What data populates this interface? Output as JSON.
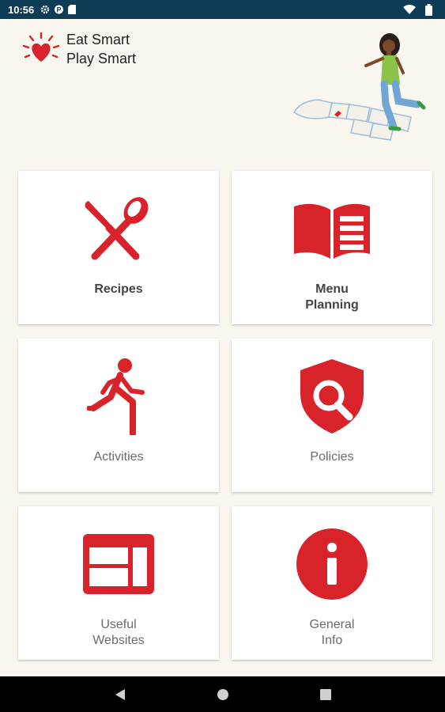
{
  "status_bar": {
    "time": "10:56",
    "icons": [
      "settings-icon",
      "parking-icon",
      "sd-card-icon"
    ],
    "right_icons": [
      "wifi-icon",
      "battery-icon"
    ]
  },
  "brand": {
    "line1": "Eat Smart",
    "line2": "Play Smart",
    "logo": "heart-sun-icon",
    "color": "#d8232a"
  },
  "tiles": [
    {
      "label": "Recipes",
      "icon": "fork-knife-spoon-icon"
    },
    {
      "label": "Menu\nPlanning",
      "icon": "open-book-icon"
    },
    {
      "label": "Activities",
      "icon": "running-person-icon"
    },
    {
      "label": "Policies",
      "icon": "shield-search-icon"
    },
    {
      "label": "Useful\nWebsites",
      "icon": "web-layout-icon"
    },
    {
      "label": "General\nInfo",
      "icon": "info-icon"
    }
  ],
  "nav_bar": {
    "buttons": [
      "back-icon",
      "home-icon",
      "recents-icon"
    ]
  },
  "colors": {
    "accent": "#d8232a",
    "background": "#f8f6ee",
    "status_bar": "#0e3b55"
  }
}
